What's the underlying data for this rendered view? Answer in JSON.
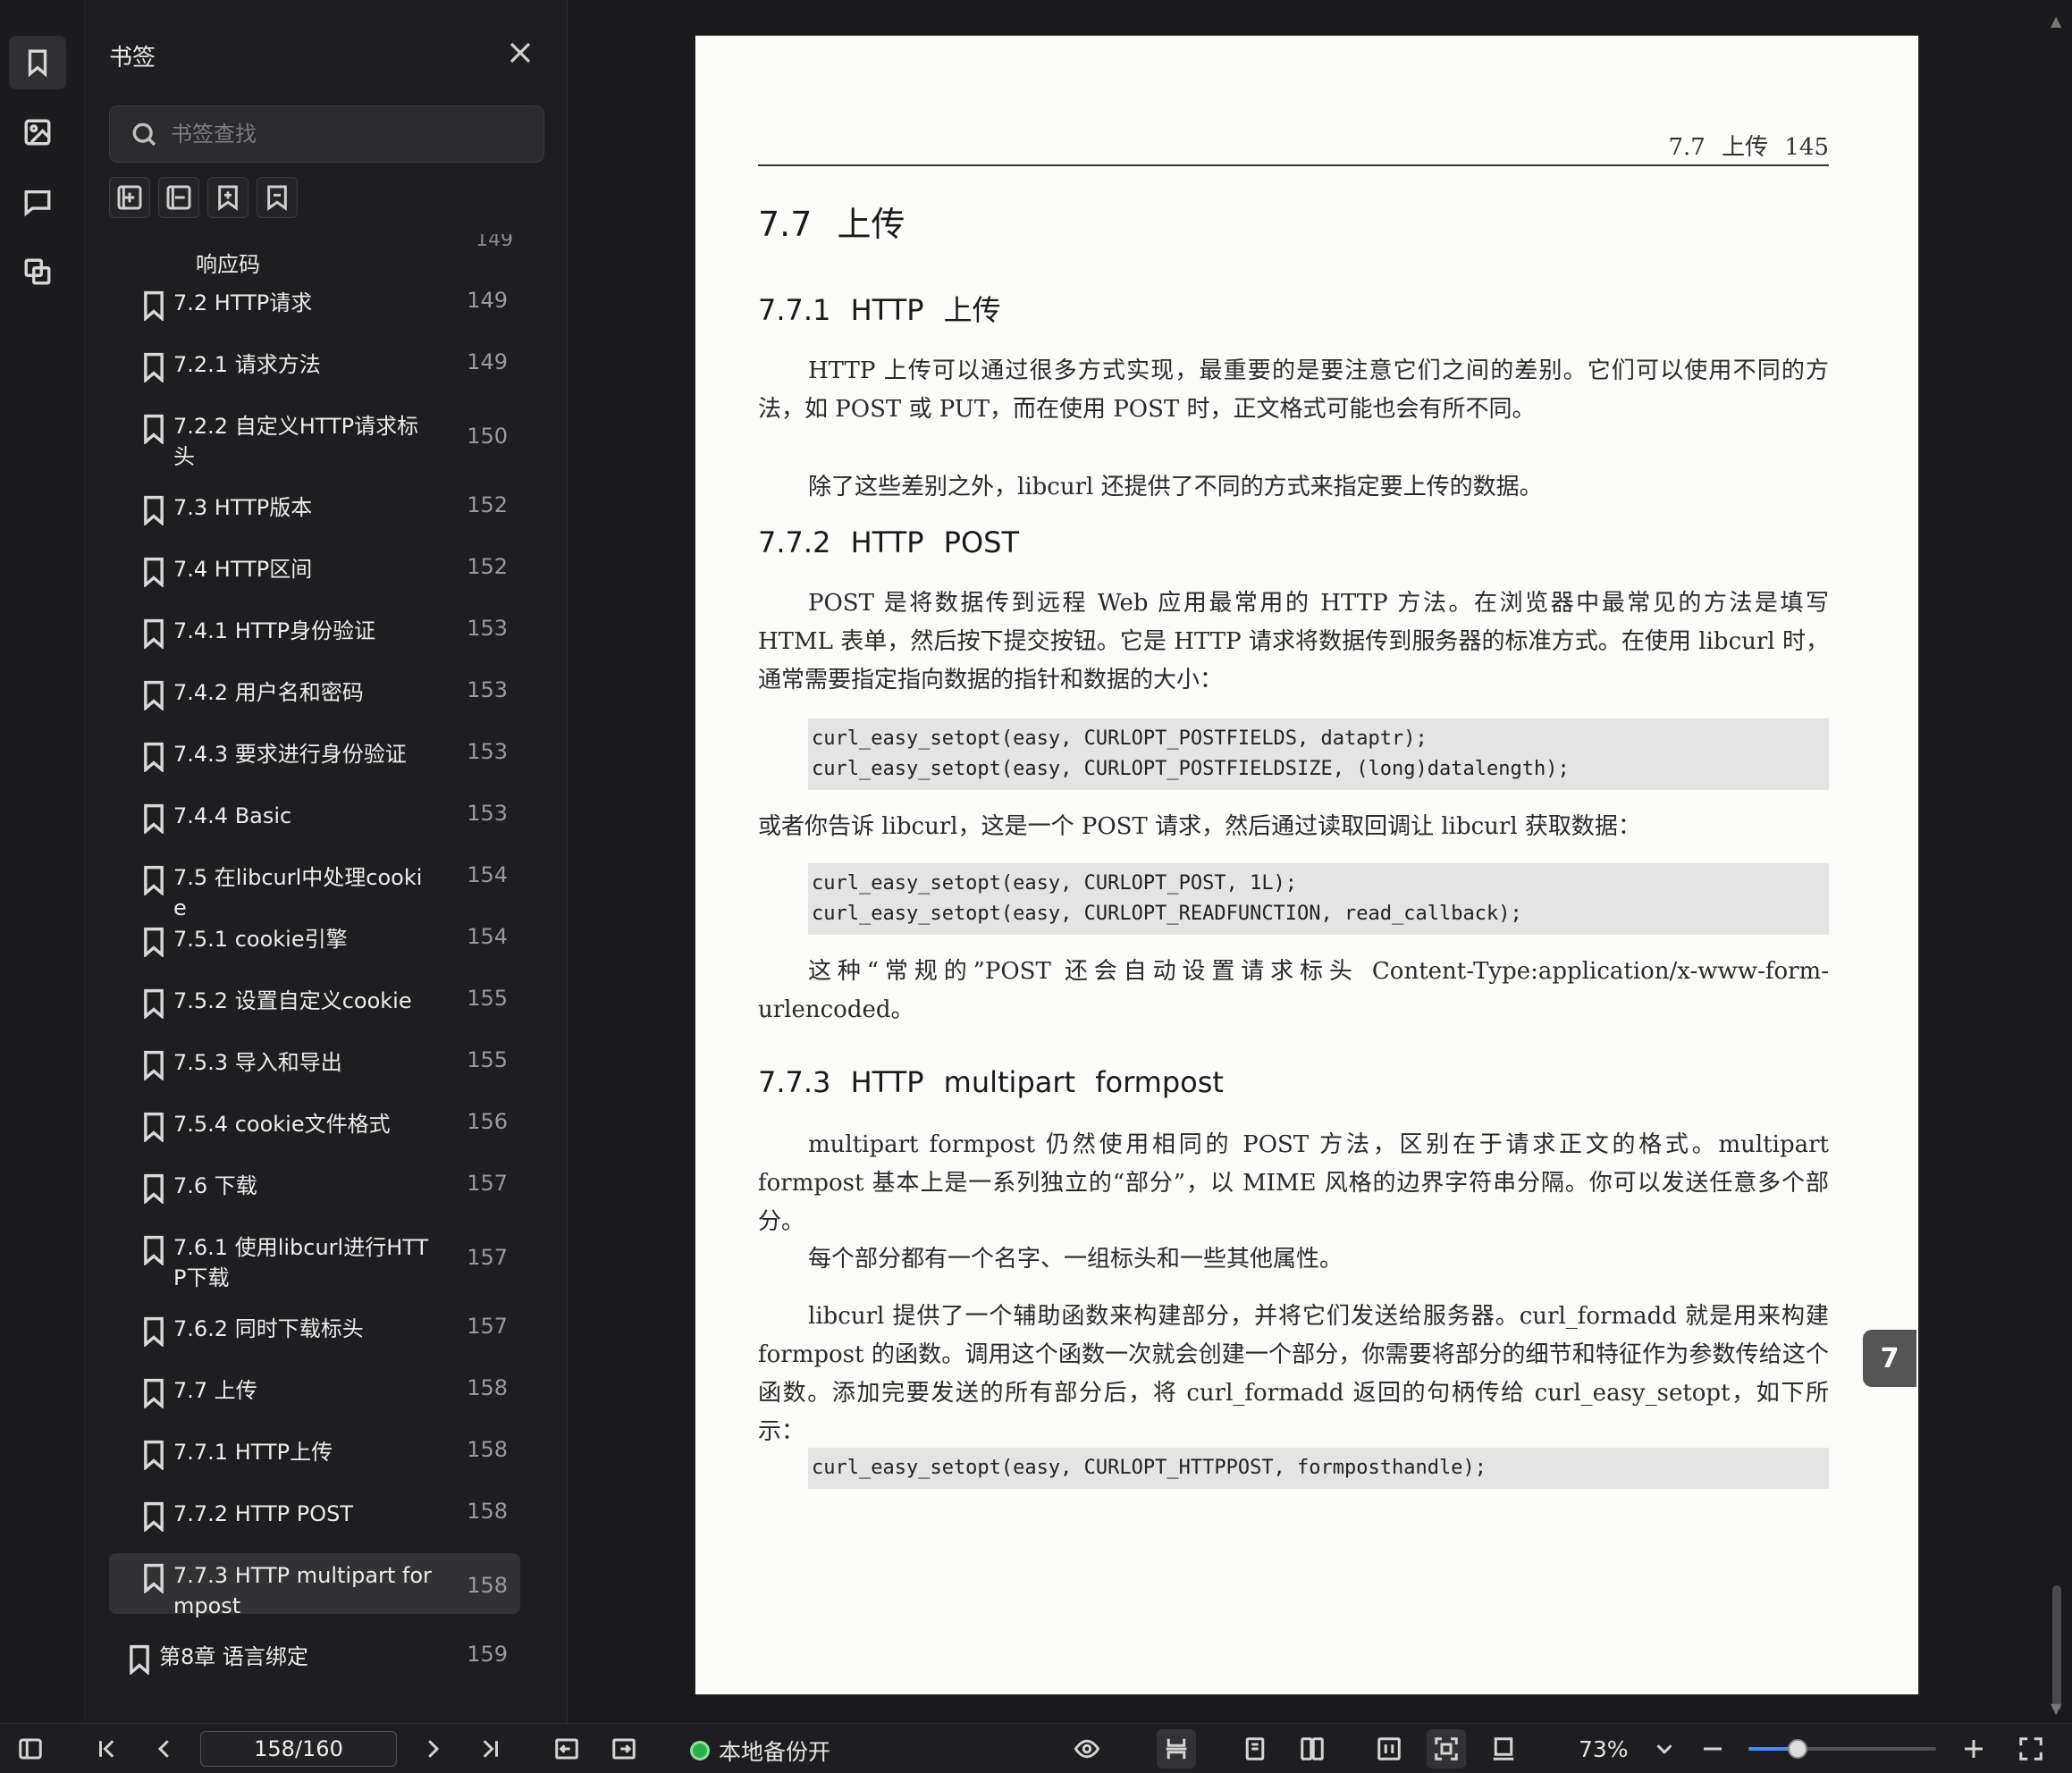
{
  "panel": {
    "title": "书签",
    "search_placeholder": "书签查找",
    "partial_item_label": "响应码",
    "partial_item_page": "149",
    "items": [
      {
        "label": "7.2  HTTP请求",
        "page": "149"
      },
      {
        "label": "7.2.1  请求方法",
        "page": "149"
      },
      {
        "label": "7.2.2  自定义HTTP请求标头",
        "page": "150"
      },
      {
        "label": "7.3  HTTP版本",
        "page": "152"
      },
      {
        "label": "7.4  HTTP区间",
        "page": "152"
      },
      {
        "label": "7.4.1  HTTP身份验证",
        "page": "153"
      },
      {
        "label": "7.4.2  用户名和密码",
        "page": "153"
      },
      {
        "label": "7.4.3  要求进行身份验证",
        "page": "153"
      },
      {
        "label": "7.4.4  Basic",
        "page": "153"
      },
      {
        "label": "7.5  在libcurl中处理cookie",
        "page": "154"
      },
      {
        "label": "7.5.1  cookie引擎",
        "page": "154"
      },
      {
        "label": "7.5.2  设置自定义cookie",
        "page": "155"
      },
      {
        "label": "7.5.3  导入和导出",
        "page": "155"
      },
      {
        "label": "7.5.4  cookie文件格式",
        "page": "156"
      },
      {
        "label": "7.6  下载",
        "page": "157"
      },
      {
        "label": "7.6.1  使用libcurl进行HTTP下载",
        "page": "157"
      },
      {
        "label": "7.6.2  同时下载标头",
        "page": "157"
      },
      {
        "label": "7.7  上传",
        "page": "158"
      },
      {
        "label": "7.7.1  HTTP上传",
        "page": "158"
      },
      {
        "label": "7.7.2  HTTP POST",
        "page": "158"
      },
      {
        "label": "7.7.3  HTTP multipart formpost",
        "page": "158"
      },
      {
        "label": "第8章  语言绑定",
        "page": "159"
      }
    ]
  },
  "page": {
    "header": "7.7  上传    145",
    "h1": "7.7  上传",
    "h2_1": "7.7.1  HTTP 上传",
    "p1": "HTTP 上传可以通过很多方式实现，最重要的是要注意它们之间的差别。它们可以使用不同的方法，如 POST 或 PUT，而在使用 POST 时，正文格式可能也会有所不同。",
    "p2": "除了这些差别之外，libcurl 还提供了不同的方式来指定要上传的数据。",
    "h2_2": "7.7.2  HTTP POST",
    "p3": "POST 是将数据传到远程 Web 应用最常用的 HTTP 方法。在浏览器中最常见的方法是填写 HTML 表单，然后按下提交按钮。它是 HTTP 请求将数据传到服务器的标准方式。在使用 libcurl 时，通常需要指定指向数据的指针和数据的大小：",
    "code1": "curl_easy_setopt(easy, CURLOPT_POSTFIELDS, dataptr);\ncurl_easy_setopt(easy, CURLOPT_POSTFIELDSIZE, (long)datalength);",
    "p4": "或者你告诉 libcurl，这是一个 POST 请求，然后通过读取回调让 libcurl 获取数据：",
    "code2": "curl_easy_setopt(easy, CURLOPT_POST, 1L);\ncurl_easy_setopt(easy, CURLOPT_READFUNCTION, read_callback);",
    "p5": "这种“常规的”POST 还会自动设置请求标头 Content-Type:application/x-www-form-urlencoded。",
    "h2_3": "7.7.3  HTTP multipart formpost",
    "p6": "multipart formpost 仍然使用相同的 POST 方法，区别在于请求正文的格式。multipart formpost 基本上是一系列独立的“部分”，以 MIME 风格的边界字符串分隔。你可以发送任意多个部分。",
    "p7": "每个部分都有一个名字、一组标头和一些其他属性。",
    "p8": "libcurl 提供了一个辅助函数来构建部分，并将它们发送给服务器。curl_formadd 就是用来构建 formpost 的函数。调用这个函数一次就会创建一个部分，你需要将部分的细节和特征作为参数传给这个函数。添加完要发送的所有部分后，将 curl_formadd 返回的句柄传给 curl_easy_setopt，如下所示：",
    "code3": "curl_easy_setopt(easy, CURLOPT_HTTPPOST, formposthandle);",
    "chapter_tab": "7"
  },
  "toolbar": {
    "page_indicator": "158/160",
    "backup_label": "本地备份开",
    "zoom": "73%",
    "zoom_slider_fraction": 0.26
  },
  "colors": {
    "accent": "#4a8cf7",
    "backup_dot": "#2ab24a"
  }
}
